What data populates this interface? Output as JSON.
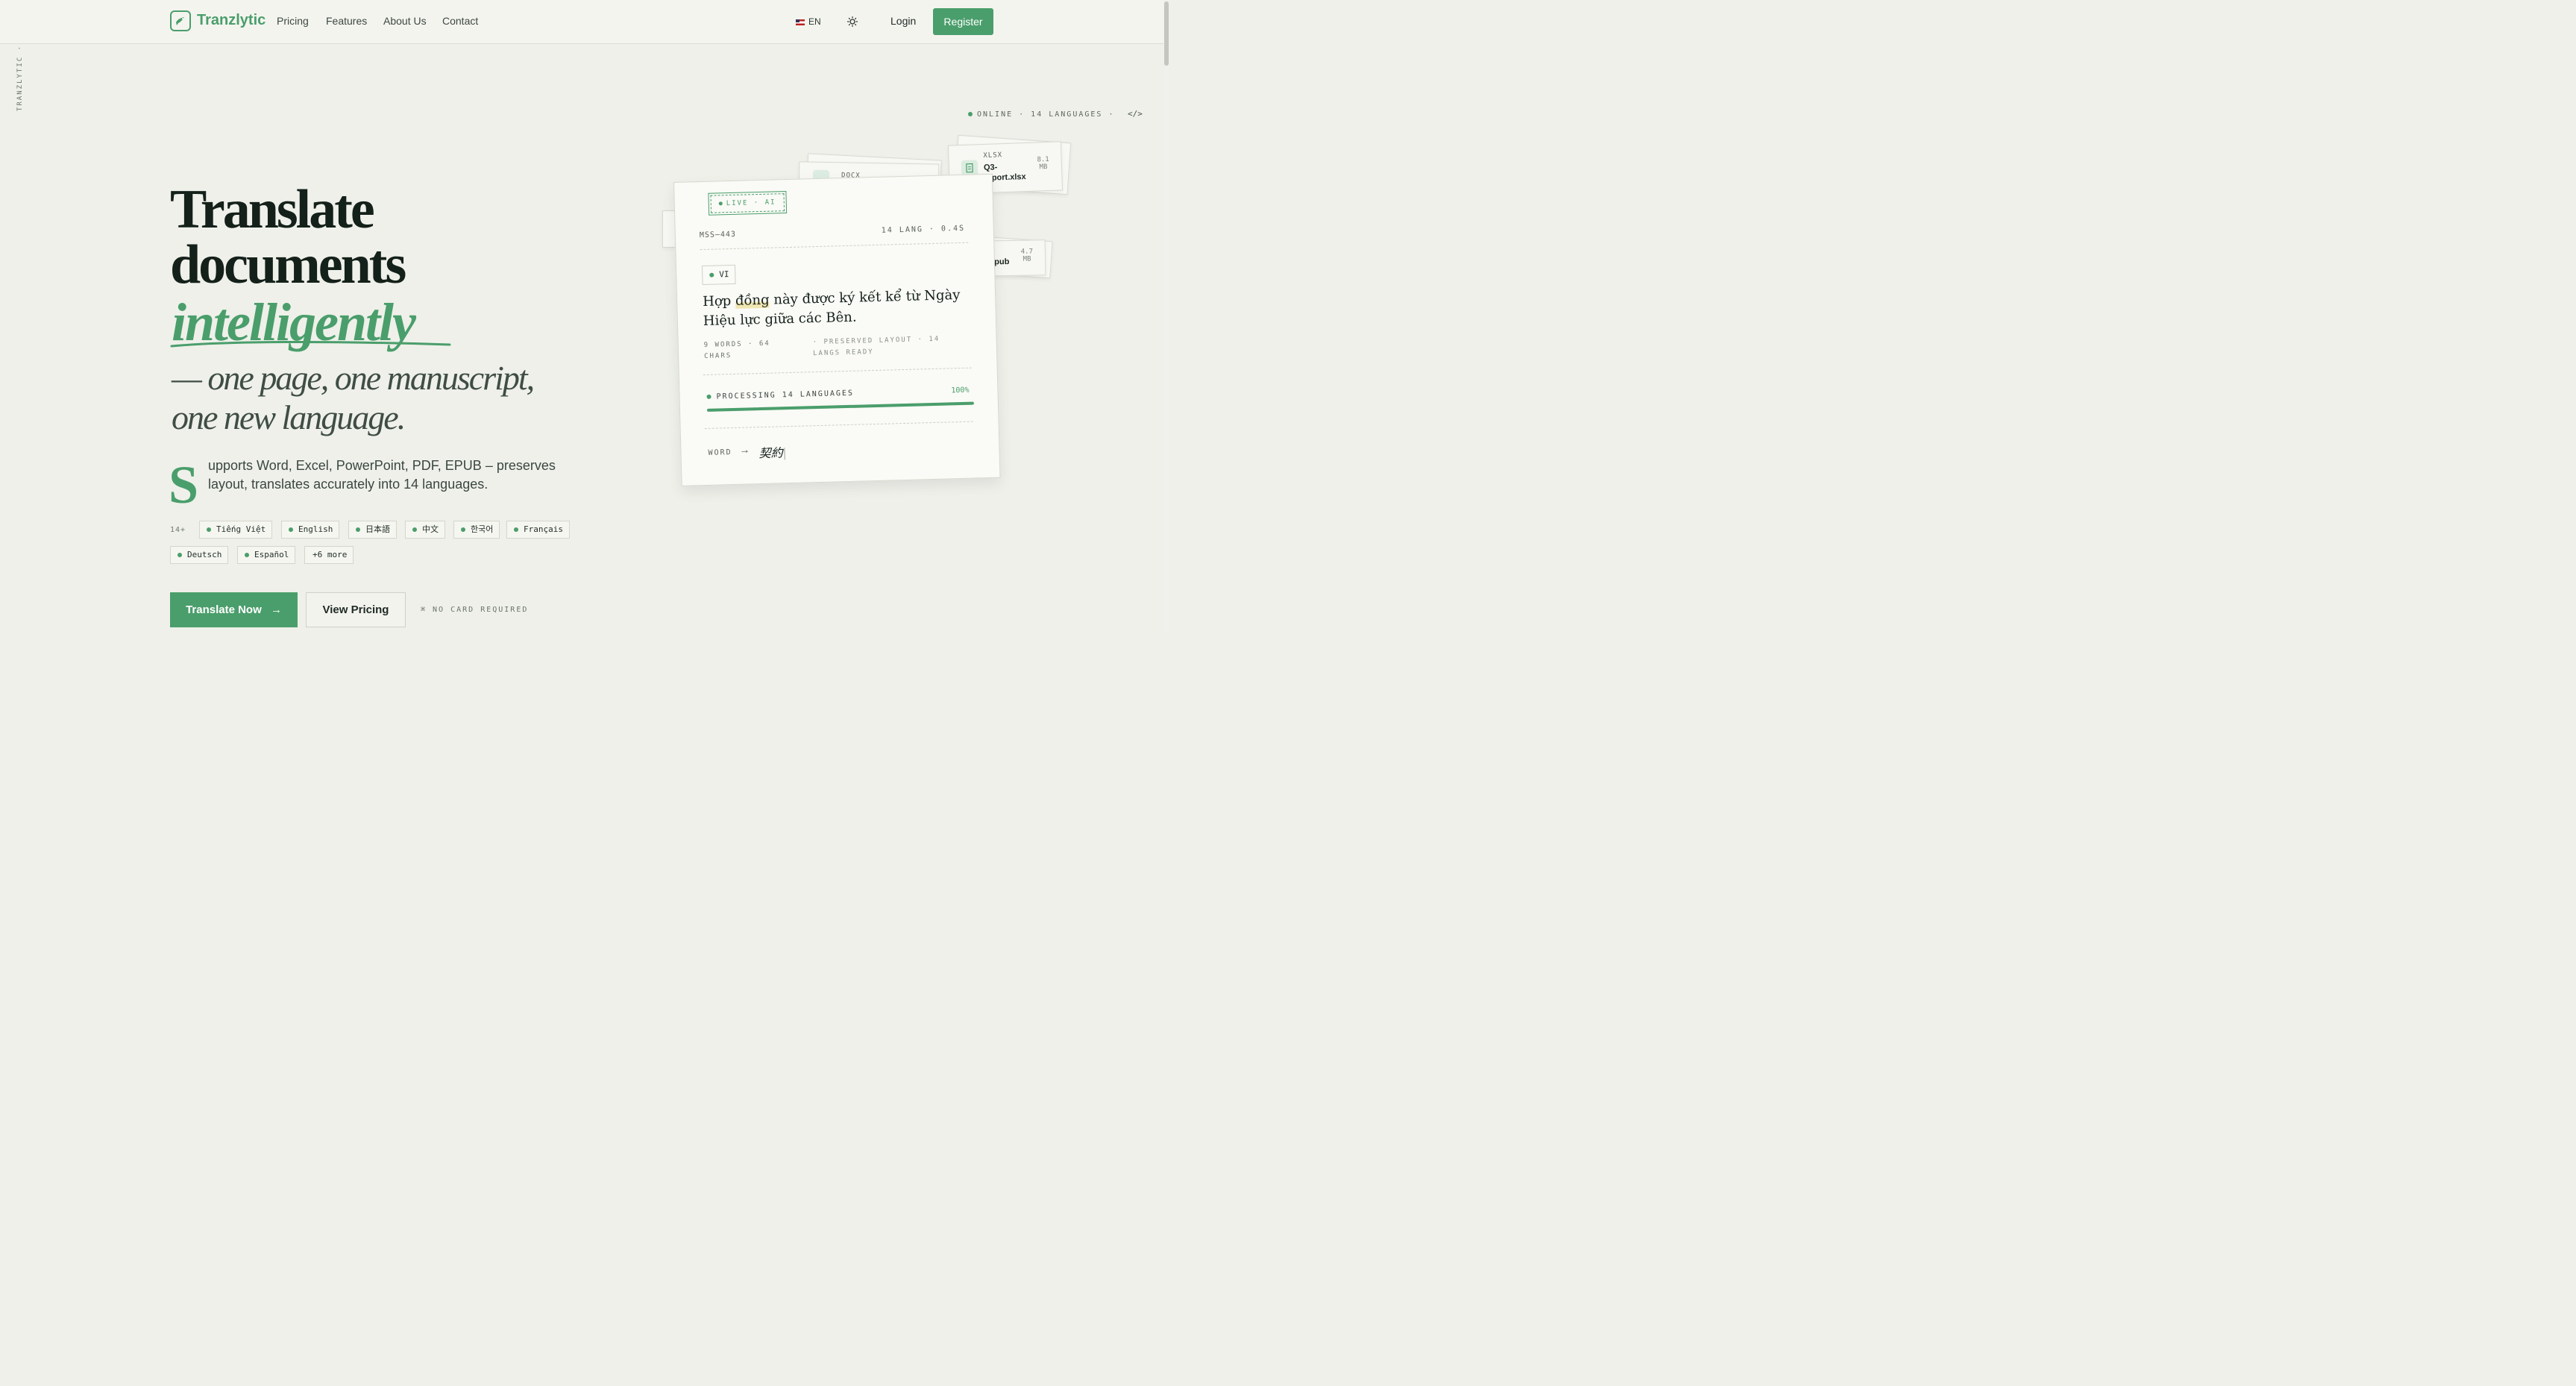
{
  "nav": {
    "brand": "Tranzlytic",
    "links": [
      "Pricing",
      "Features",
      "About Us",
      "Contact"
    ],
    "language": "EN",
    "login": "Login",
    "register": "Register"
  },
  "side_label": "TRANZLYTIC ·",
  "status": {
    "text": "ONLINE · 14 LANGUAGES ·",
    "code_icon": "</>"
  },
  "hero": {
    "title_line1": "Translate",
    "title_line2": "documents",
    "title_accent": "intelligently",
    "subtitle_line1": "— one page, one manuscript,",
    "subtitle_line2": "one new language.",
    "drop_cap": "S",
    "description": "upports Word, Excel, PowerPoint, PDF, EPUB – preserves layout, translates accurately into 14 languages.",
    "lang_count": "14+",
    "languages": [
      "Tiếng Việt",
      "English",
      "日本語",
      "中文",
      "한국어",
      "Français",
      "Deutsch",
      "Español"
    ],
    "more": "+6 more",
    "cta_primary": "Translate Now",
    "cta_secondary": "View Pricing",
    "note": "⌘ NO CARD REQUIRED"
  },
  "files": [
    {
      "type": "DOCX",
      "name": "",
      "size": ""
    },
    {
      "type": "XLSX",
      "name": "Q3-report.xlsx",
      "size_value": "8.1",
      "size_unit": "MB"
    },
    {
      "type": "",
      "name": "epub",
      "size_value": "4.7",
      "size_unit": "MB"
    }
  ],
  "card": {
    "badge": "LIVE · AI",
    "id": "MSS—443",
    "meta": "14 LANG · 0.4S",
    "lang": "VI",
    "text_before": "Hợp ",
    "text_highlight": "đồng",
    "text_after": " này được ký kết kể từ Ngày Hiệu lực giữa các Bên.",
    "stats_left": "9 WORDS · 64 CHARS",
    "stats_right": "· PRESERVED LAYOUT · 14 LANGS READY",
    "processing": "PROCESSING 14 LANGUAGES",
    "progress_label": "100%",
    "progress": 1.0,
    "word_label": "WORD",
    "arrow": "→",
    "output": "契約"
  },
  "colors": {
    "accent": "#4a9e6b",
    "background": "#eff0ea",
    "ink": "#14201a"
  }
}
